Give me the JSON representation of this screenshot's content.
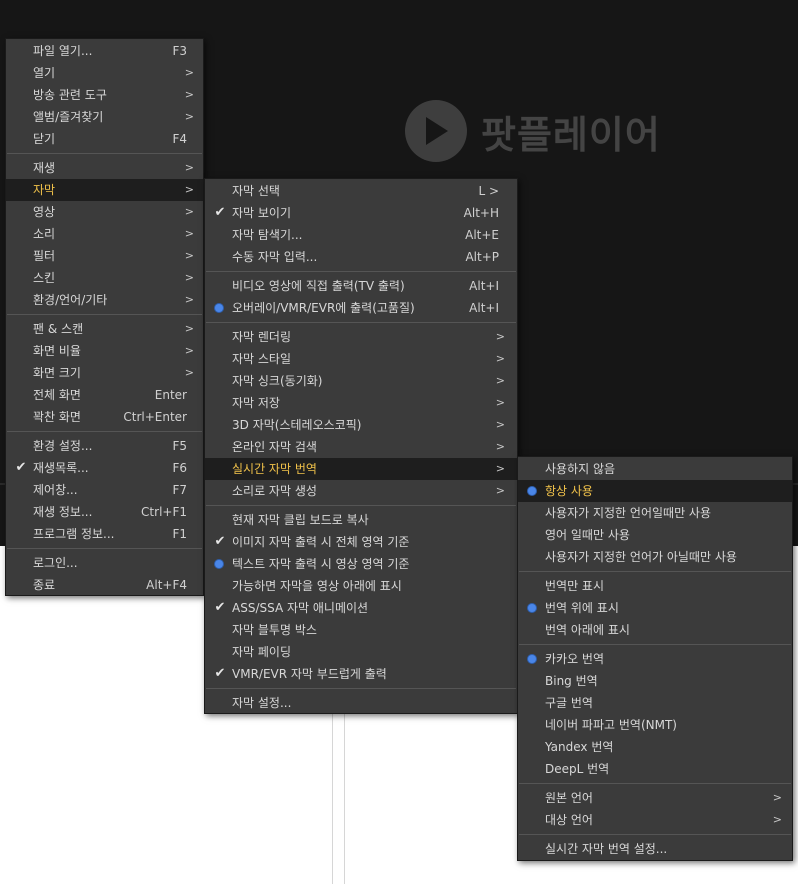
{
  "app": {
    "logo_text": "팟플레이어"
  },
  "main_menu": [
    {
      "label": "파일 열기...",
      "shortcut": "F3"
    },
    {
      "label": "열기",
      "arrow": ">"
    },
    {
      "label": "방송 관련 도구",
      "arrow": ">"
    },
    {
      "label": "앨범/즐겨찾기",
      "arrow": ">"
    },
    {
      "label": "닫기",
      "shortcut": "F4"
    },
    {
      "sep": true
    },
    {
      "label": "재생",
      "arrow": ">"
    },
    {
      "label": "자막",
      "arrow": ">",
      "highlight": true
    },
    {
      "label": "영상",
      "arrow": ">"
    },
    {
      "label": "소리",
      "arrow": ">"
    },
    {
      "label": "필터",
      "arrow": ">"
    },
    {
      "label": "스킨",
      "arrow": ">"
    },
    {
      "label": "환경/언어/기타",
      "arrow": ">"
    },
    {
      "sep": true
    },
    {
      "label": "팬 & 스캔",
      "arrow": ">"
    },
    {
      "label": "화면 비율",
      "arrow": ">"
    },
    {
      "label": "화면 크기",
      "arrow": ">"
    },
    {
      "label": "전체 화면",
      "shortcut": "Enter"
    },
    {
      "label": "꽉찬 화면",
      "shortcut": "Ctrl+Enter"
    },
    {
      "sep": true
    },
    {
      "label": "환경 설정...",
      "shortcut": "F5"
    },
    {
      "label": "재생목록...",
      "shortcut": "F6",
      "mark": "check"
    },
    {
      "label": "제어창...",
      "shortcut": "F7"
    },
    {
      "label": "재생 정보...",
      "shortcut": "Ctrl+F1"
    },
    {
      "label": "프로그램 정보...",
      "shortcut": "F1"
    },
    {
      "sep": true
    },
    {
      "label": "로그인..."
    },
    {
      "label": "종료",
      "shortcut": "Alt+F4"
    }
  ],
  "subtitle_menu": [
    {
      "label": "자막 선택",
      "shortcut": "L >"
    },
    {
      "label": "자막 보이기",
      "shortcut": "Alt+H",
      "mark": "check"
    },
    {
      "label": "자막 탐색기...",
      "shortcut": "Alt+E"
    },
    {
      "label": "수동 자막 입력...",
      "shortcut": "Alt+P"
    },
    {
      "sep": true
    },
    {
      "label": "비디오 영상에 직접 출력(TV 출력)",
      "shortcut": "Alt+I"
    },
    {
      "label": "오버레이/VMR/EVR에 출력(고품질)",
      "shortcut": "Alt+I",
      "mark": "dot"
    },
    {
      "sep": true
    },
    {
      "label": "자막 렌더링",
      "arrow": ">"
    },
    {
      "label": "자막 스타일",
      "arrow": ">"
    },
    {
      "label": "자막 싱크(동기화)",
      "arrow": ">"
    },
    {
      "label": "자막 저장",
      "arrow": ">"
    },
    {
      "label": "3D 자막(스테레오스코픽)",
      "arrow": ">"
    },
    {
      "label": "온라인 자막 검색",
      "arrow": ">"
    },
    {
      "label": "실시간 자막 번역",
      "arrow": ">",
      "highlight": true
    },
    {
      "label": "소리로 자막 생성",
      "arrow": ">"
    },
    {
      "sep": true
    },
    {
      "label": "현재 자막 클립 보드로 복사"
    },
    {
      "label": "이미지 자막 출력 시 전체 영역 기준",
      "mark": "check"
    },
    {
      "label": "텍스트 자막 출력 시 영상 영역 기준",
      "mark": "dot"
    },
    {
      "label": "가능하면 자막을 영상 아래에 표시"
    },
    {
      "label": "ASS/SSA 자막 애니메이션",
      "mark": "check"
    },
    {
      "label": "자막 블투명 박스"
    },
    {
      "label": "자막 페이딩"
    },
    {
      "label": "VMR/EVR 자막 부드럽게 출력",
      "mark": "check"
    },
    {
      "sep": true
    },
    {
      "label": "자막 설정..."
    }
  ],
  "translation_menu": [
    {
      "label": "사용하지 않음"
    },
    {
      "label": "항상 사용",
      "mark": "dot",
      "highlight": true
    },
    {
      "label": "사용자가 지정한 언어일때만 사용"
    },
    {
      "label": "영어 일때만 사용"
    },
    {
      "label": "사용자가 지정한 언어가 아닐때만 사용"
    },
    {
      "sep": true
    },
    {
      "label": "번역만 표시"
    },
    {
      "label": "번역 위에 표시",
      "mark": "dot"
    },
    {
      "label": "번역 아래에 표시"
    },
    {
      "sep": true
    },
    {
      "label": "카카오 번역",
      "mark": "dot"
    },
    {
      "label": "Bing 번역"
    },
    {
      "label": "구글 번역"
    },
    {
      "label": "네이버 파파고 번역(NMT)"
    },
    {
      "label": "Yandex 번역"
    },
    {
      "label": "DeepL 번역"
    },
    {
      "sep": true
    },
    {
      "label": "원본 언어",
      "arrow": ">"
    },
    {
      "label": "대상 언어",
      "arrow": ">"
    },
    {
      "sep": true
    },
    {
      "label": "실시간 자막 번역 설정..."
    }
  ]
}
